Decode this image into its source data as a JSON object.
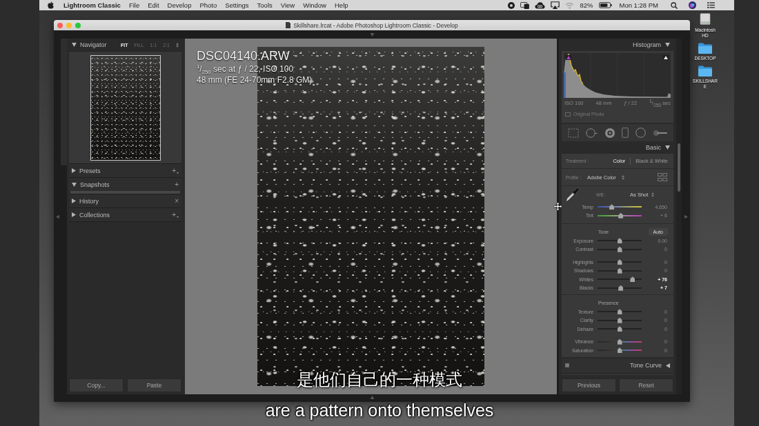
{
  "menubar": {
    "app_name": "Lightroom Classic",
    "menus": [
      "File",
      "Edit",
      "Develop",
      "Photo",
      "Settings",
      "Tools",
      "View",
      "Window",
      "Help"
    ],
    "battery": "82%",
    "clock": "Mon 1:28 PM"
  },
  "desktop_icons": [
    {
      "kind": "drive",
      "label": "Macintosh HD"
    },
    {
      "kind": "folder",
      "label": "DESKTOP"
    },
    {
      "kind": "folder",
      "label": "SKILLSHARE"
    }
  ],
  "window": {
    "title": "Skillshare.lrcat - Adobe Photoshop Lightroom Classic - Develop"
  },
  "left_panel": {
    "navigator": {
      "title": "Navigator",
      "expanded": true,
      "zoom_options": [
        {
          "label": "FIT",
          "selected": true
        },
        {
          "label": "FILL",
          "selected": false
        },
        {
          "label": "1:1",
          "selected": false
        },
        {
          "label": "2:1",
          "selected": false
        }
      ]
    },
    "sections": [
      {
        "title": "Presets",
        "expanded": false,
        "action": "+",
        "menu": true
      },
      {
        "title": "Snapshots",
        "expanded": true,
        "action": "+",
        "menu": false
      },
      {
        "title": "History",
        "expanded": false,
        "action": "×",
        "menu": false
      },
      {
        "title": "Collections",
        "expanded": false,
        "action": "+",
        "menu": true
      }
    ],
    "buttons": [
      "Copy...",
      "Paste"
    ]
  },
  "image": {
    "filename": "DSC04140.ARW",
    "exposure": "$^{1}$/$_{250}$ sec at ƒ / 22, ISO 100",
    "lens": "48 mm (FE 24-70mm F2.8 GM)"
  },
  "right_panel": {
    "histogram": {
      "title": "Histogram",
      "expanded": true,
      "info": [
        "ISO 100",
        "48 mm",
        "ƒ / 22",
        "$^{1}$/$_{250}$ sec"
      ],
      "original_photo": {
        "label": "Original Photo",
        "checked": false
      }
    },
    "basic": {
      "title": "Basic",
      "expanded": true,
      "treatment": {
        "label": "Treatment :",
        "options": [
          {
            "label": "Color",
            "selected": true
          },
          {
            "label": "Black & White",
            "selected": false
          }
        ]
      },
      "profile": {
        "label": "Profile :",
        "value": "Adobe Color"
      },
      "white_balance": {
        "label": "WB :",
        "value": "As Shot",
        "sliders": [
          {
            "label": "Temp",
            "kind": "temp",
            "level": 0.3,
            "value": "4,650",
            "emphasized": false
          },
          {
            "label": "Tint",
            "kind": "tint",
            "level": 0.53,
            "value": "+ 6",
            "emphasized": false
          }
        ]
      },
      "sections": [
        {
          "title": "Tone",
          "action": "Auto",
          "slider_sets": [
            [
              {
                "label": "Exposure",
                "kind": "plain",
                "level": 0.5,
                "value": "0.00",
                "emphasized": false
              },
              {
                "label": "Contrast",
                "kind": "plain",
                "level": 0.5,
                "value": "0",
                "emphasized": false
              }
            ],
            [
              {
                "label": "Highlights",
                "kind": "plain",
                "level": 0.5,
                "value": "0",
                "emphasized": false
              },
              {
                "label": "Shadows",
                "kind": "plain",
                "level": 0.5,
                "value": "0",
                "emphasized": false
              },
              {
                "label": "Whites",
                "kind": "plain",
                "level": 0.83,
                "value": "+ 76",
                "emphasized": true
              },
              {
                "label": "Blacks",
                "kind": "plain",
                "level": 0.53,
                "value": "+ 7",
                "emphasized": true
              }
            ]
          ]
        },
        {
          "title": "Presence",
          "slider_sets": [
            [
              {
                "label": "Texture",
                "kind": "plain",
                "level": 0.5,
                "value": "0",
                "emphasized": false
              },
              {
                "label": "Clarity",
                "kind": "plain",
                "level": 0.5,
                "value": "0",
                "emphasized": false
              },
              {
                "label": "Dehaze",
                "kind": "plain",
                "level": 0.5,
                "value": "0",
                "emphasized": false
              }
            ],
            [
              {
                "label": "Vibrance",
                "kind": "color",
                "level": 0.5,
                "value": "0",
                "emphasized": false
              },
              {
                "label": "Saturation",
                "kind": "color",
                "level": 0.5,
                "value": "0",
                "emphasized": false
              }
            ]
          ]
        }
      ]
    },
    "tone_curve": {
      "title": "Tone Curve",
      "expanded": false,
      "switch_on": true
    },
    "buttons": [
      "Previous",
      "Reset"
    ]
  },
  "subtitles": [
    "是他们自己的一种模式",
    "are a pattern onto themselves"
  ]
}
